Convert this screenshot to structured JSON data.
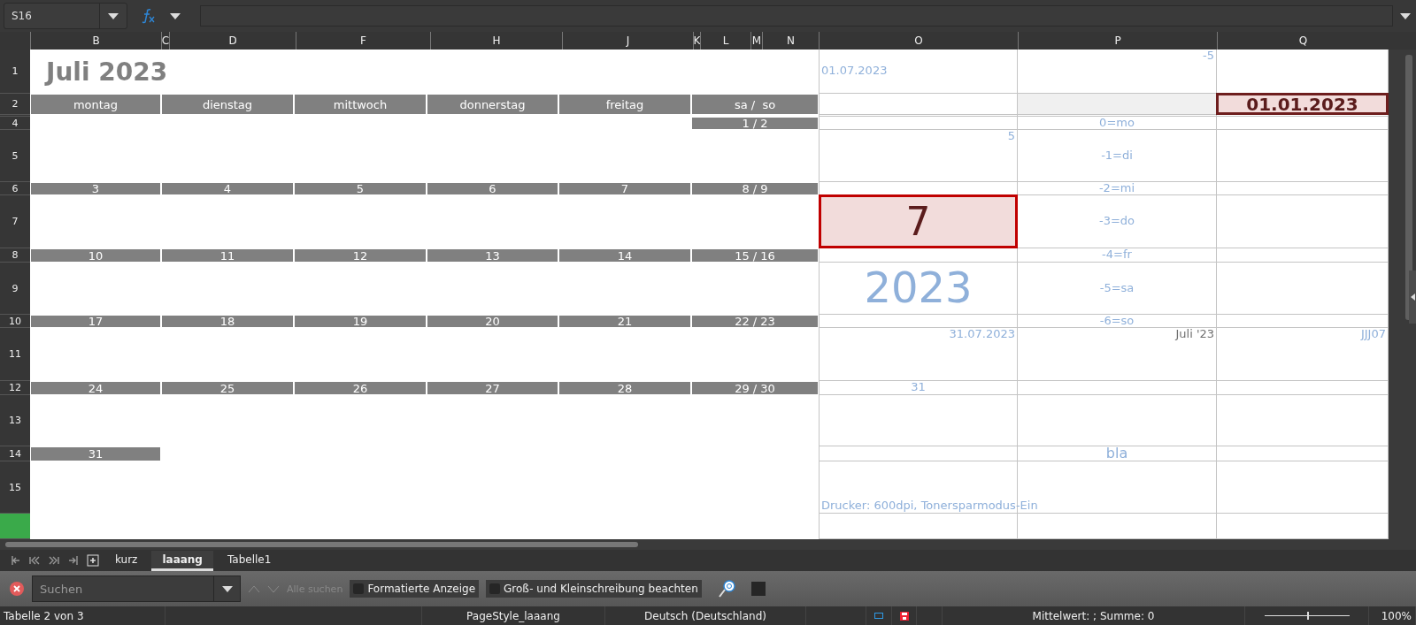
{
  "name_box": {
    "value": "S16"
  },
  "columns": [
    "B",
    "C",
    "D",
    "F",
    "H",
    "J",
    "K",
    "L",
    "M",
    "N",
    "O",
    "P",
    "Q"
  ],
  "rows": [
    {
      "label": "1",
      "selected": false,
      "o": {
        "text": "01.07.2023",
        "kind": "left"
      },
      "p": {
        "text": "-5",
        "kind": "right"
      }
    },
    {
      "label": "2",
      "selected": false,
      "p": {
        "kind": "shaded"
      },
      "q": {
        "text": "01.01.2023",
        "kind": "highlight"
      }
    },
    {
      "selected": false
    },
    {
      "label": "4",
      "selected": false,
      "p": {
        "text": "0=mo",
        "kind": "center"
      }
    },
    {
      "label": "5",
      "selected": false,
      "o": {
        "text": "5",
        "kind": "right"
      },
      "p": {
        "text": "-1=di",
        "kind": "center"
      }
    },
    {
      "label": "6",
      "selected": false,
      "p": {
        "text": "-2=mi",
        "kind": "center"
      }
    },
    {
      "label": "7",
      "selected": false,
      "o": {
        "text": "7",
        "kind": "marker"
      },
      "p": {
        "text": "-3=do",
        "kind": "center"
      }
    },
    {
      "label": "8",
      "selected": false,
      "p": {
        "text": "-4=fr",
        "kind": "center"
      }
    },
    {
      "label": "9",
      "selected": false,
      "o": {
        "text": "2023",
        "kind": "big"
      },
      "p": {
        "text": "-5=sa",
        "kind": "center"
      }
    },
    {
      "label": "10",
      "selected": false,
      "p": {
        "text": "-6=so",
        "kind": "center"
      }
    },
    {
      "label": "11",
      "selected": false,
      "o": {
        "text": "31.07.2023",
        "kind": "right"
      },
      "p": {
        "text": "Juli '23",
        "kind": "dark"
      },
      "q": {
        "text": "JJJ07",
        "kind": "right"
      }
    },
    {
      "label": "12",
      "selected": false,
      "o": {
        "text": "31",
        "kind": "center"
      }
    },
    {
      "label": "13",
      "selected": false
    },
    {
      "label": "14",
      "selected": false,
      "p": {
        "text": "bla",
        "kind": "note"
      }
    },
    {
      "label": "15",
      "selected": false,
      "o": {
        "text": "Drucker: 600dpi, Tonersparmodus-Ein",
        "kind": "bottom"
      }
    },
    {
      "selected": true
    }
  ],
  "calendar": {
    "title": "Juli 2023",
    "weekdays": [
      "montag",
      "dienstag",
      "mittwoch",
      "donnerstag",
      "freitag",
      "sa /  so"
    ],
    "weeks": [
      {
        "weekend": "1 / 2"
      },
      {
        "days": [
          "3",
          "4",
          "5",
          "6",
          "7"
        ],
        "weekend": "8 / 9"
      },
      {
        "days": [
          "10",
          "11",
          "12",
          "13",
          "14"
        ],
        "weekend": "15 / 16"
      },
      {
        "days": [
          "17",
          "18",
          "19",
          "20",
          "21"
        ],
        "weekend": "22 / 23"
      },
      {
        "days": [
          "24",
          "25",
          "26",
          "27",
          "28"
        ],
        "weekend": "29 / 30"
      },
      {
        "days": [
          "31"
        ]
      }
    ]
  },
  "sheet_tabs": [
    {
      "label": "kurz",
      "selected": false
    },
    {
      "label": "laaang",
      "selected": true
    },
    {
      "label": "Tabelle1",
      "selected": false
    }
  ],
  "find_bar": {
    "placeholder": "Suchen",
    "navigation_disabled": true,
    "find_all": "Alle suchen",
    "options": [
      {
        "label": "Formatierte Anzeige",
        "checked": false
      },
      {
        "label": "Groß- und Kleinschreibung beachten",
        "checked": false
      }
    ]
  },
  "status_bar": {
    "sheet": "Tabelle 2 von 3",
    "page_style": "PageStyle_laaang",
    "language": "Deutsch (Deutschland)",
    "summary": "Mittelwert: ; Summe: 0",
    "zoom": {
      "level": 0.5
    },
    "zoom_reading": "100%"
  }
}
